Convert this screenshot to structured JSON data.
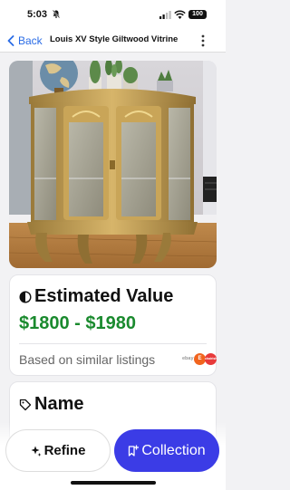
{
  "status_bar": {
    "time": "5:03",
    "battery": "100"
  },
  "nav": {
    "back_label": "Back",
    "title": "Louis XV Style Giltwood Vitrine"
  },
  "photo": {
    "alt": "Gilded curio cabinet with glass doors and plants on top"
  },
  "estimated_value": {
    "title": "Estimated Value",
    "price_range": "$1800 - $1980",
    "basis": "Based on similar listings",
    "sources": [
      "ebay",
      "etsy",
      "chairish"
    ],
    "source_labels": {
      "ebay": "ebay",
      "etsy": "E",
      "chairish": "chairish"
    }
  },
  "name_card": {
    "title": "Name"
  },
  "actions": {
    "refine_label": "Refine",
    "collection_label": "Collection"
  },
  "colors": {
    "accent": "#3b3ce6",
    "price_green": "#1a8a2e",
    "link_blue": "#2a6ce6"
  }
}
